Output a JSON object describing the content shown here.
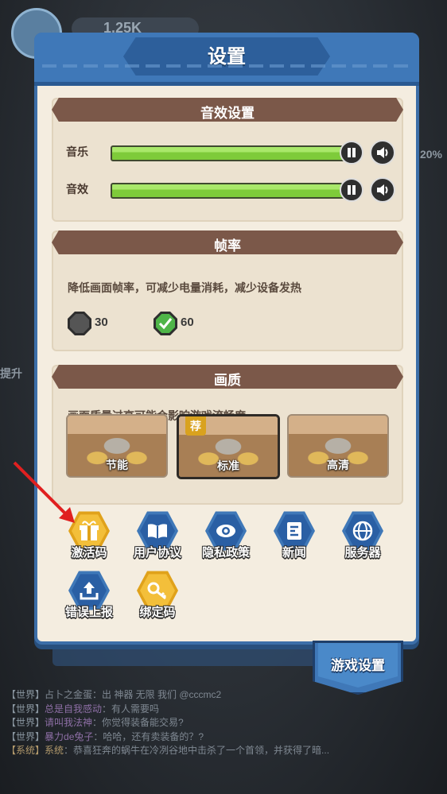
{
  "hud": {
    "currency": "1.25K"
  },
  "side": {
    "left_text": "提升",
    "right_text": "20%"
  },
  "dialog": {
    "title": "设置",
    "sound": {
      "title": "音效设置",
      "rows": [
        {
          "label": "音乐",
          "level": 1.0
        },
        {
          "label": "音效",
          "level": 1.0
        }
      ]
    },
    "fps": {
      "title": "帧率",
      "description": "降低画面帧率，可减少电量消耗，减少设备发热",
      "options": [
        {
          "value": "30",
          "selected": false
        },
        {
          "value": "60",
          "selected": true
        }
      ]
    },
    "quality": {
      "title": "画质",
      "description": "画面质量过高可能会影响游戏流畅度",
      "recommend_badge": "荐",
      "options": [
        {
          "label": "节能",
          "selected": false
        },
        {
          "label": "标准",
          "selected": true
        },
        {
          "label": "高清",
          "selected": false
        }
      ]
    },
    "buttons": [
      {
        "label": "激活码",
        "icon": "gift-icon",
        "color": "#e0a21b"
      },
      {
        "label": "用户协议",
        "icon": "book-icon",
        "color": "#3f78b8"
      },
      {
        "label": "隐私政策",
        "icon": "eye-icon",
        "color": "#3f78b8"
      },
      {
        "label": "新闻",
        "icon": "news-icon",
        "color": "#3f78b8"
      },
      {
        "label": "服务器",
        "icon": "globe-icon",
        "color": "#3f78b8"
      },
      {
        "label": "错误上报",
        "icon": "upload-icon",
        "color": "#3f78b8"
      },
      {
        "label": "绑定码",
        "icon": "key-icon",
        "color": "#e0a21b"
      }
    ]
  },
  "tab": {
    "label": "游戏设置"
  },
  "chat": [
    {
      "channel": "【世界】",
      "name": "",
      "text": "占卜之金蛋：出 神器 无限 我们 @cccmc2"
    },
    {
      "channel": "【世界】",
      "name": "总是自我感动",
      "text": "：有人需要吗"
    },
    {
      "channel": "【世界】",
      "name": "请叫我法神",
      "text": "：你觉得装备能交易?"
    },
    {
      "channel": "【世界】",
      "name": "暴力de兔子",
      "text": "：哈哈，还有卖装备的？?"
    },
    {
      "channel": "【系统】",
      "name": "系统",
      "text": "：恭喜狂奔的蜗牛在冷冽谷地中击杀了一个首领，并获得了暗..."
    }
  ]
}
